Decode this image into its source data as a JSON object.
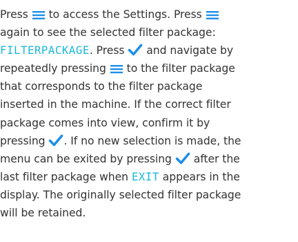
{
  "colors": {
    "text": "#333333",
    "display_text": "#18b8d8",
    "checkmark": "#1e8ee8"
  },
  "icons": {
    "menu": "menu-icon",
    "confirm": "checkmark-icon"
  },
  "paragraph": {
    "l1a": "Press ",
    "l1b": " to access the Settings. Press ",
    "l2a": "again to see the selected filter package:",
    "l3_display": "FILTERPACKAGE",
    "l3b": ". Press ",
    "l3c": " and navigate by",
    "l4a": "repeatedly pressing ",
    "l4b": " to the filter package",
    "l5": "that corresponds to the filter package",
    "l6": "inserted in the machine. If the correct filter",
    "l7": "package comes into view, confirm it by",
    "l8a": "pressing ",
    "l8b": ". If no new selection is made, the",
    "l9": "menu can be exited by pressing ",
    "l9b": " after the",
    "l10a": "last filter package when ",
    "l10_display": "EXIT",
    "l10b": " appears in the",
    "l11": "display. The originally selected filter package",
    "l12": "will be retained."
  }
}
